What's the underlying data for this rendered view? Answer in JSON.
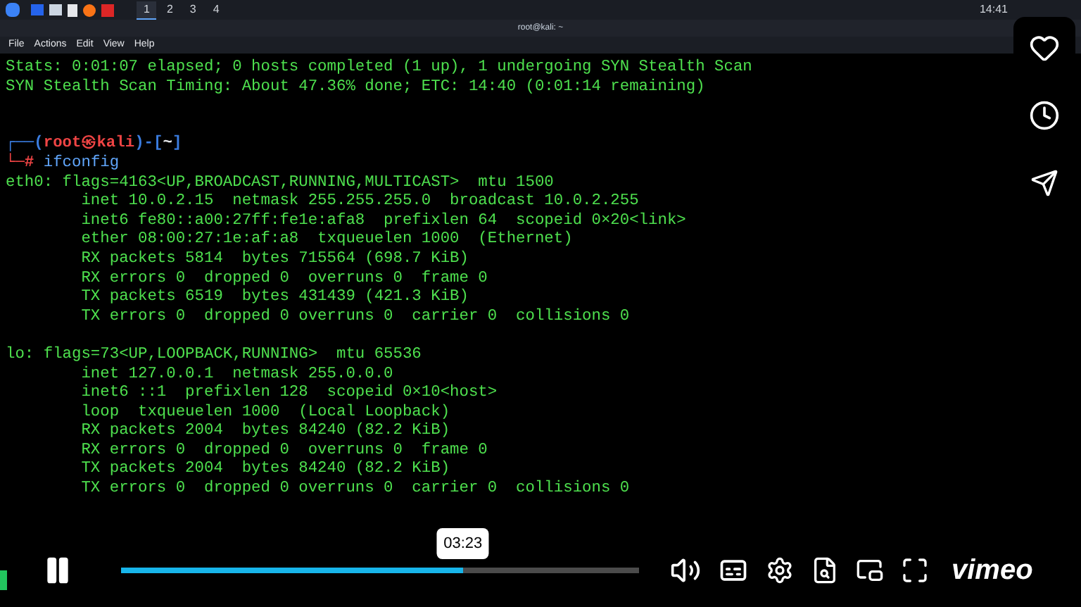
{
  "taskbar": {
    "workspaces": [
      {
        "label": "1",
        "selected": true
      },
      {
        "label": "2",
        "selected": false
      },
      {
        "label": "3",
        "selected": false
      },
      {
        "label": "4",
        "selected": false
      }
    ],
    "clock": "14:41"
  },
  "terminal": {
    "title": "root@kali: ~",
    "menu": [
      "File",
      "Actions",
      "Edit",
      "View",
      "Help"
    ],
    "lines": [
      {
        "kind": "output",
        "text": "Stats: 0:01:07 elapsed; 0 hosts completed (1 up), 1 undergoing SYN Stealth Scan"
      },
      {
        "kind": "output",
        "text": "SYN Stealth Scan Timing: About 47.36% done; ETC: 14:40 (0:01:14 remaining)"
      },
      {
        "kind": "blank"
      },
      {
        "kind": "blank"
      },
      {
        "kind": "prompt",
        "open": "┌──(",
        "user": "root㉿kali",
        "mid": ")-[",
        "dir": "~",
        "close": "]"
      },
      {
        "kind": "command",
        "mark": "└─#",
        "text": "ifconfig"
      },
      {
        "kind": "output",
        "text": "eth0: flags=4163<UP,BROADCAST,RUNNING,MULTICAST>  mtu 1500"
      },
      {
        "kind": "output",
        "text": "        inet 10.0.2.15  netmask 255.255.255.0  broadcast 10.0.2.255"
      },
      {
        "kind": "output",
        "text": "        inet6 fe80::a00:27ff:fe1e:afa8  prefixlen 64  scopeid 0×20<link>"
      },
      {
        "kind": "output",
        "text": "        ether 08:00:27:1e:af:a8  txqueuelen 1000  (Ethernet)"
      },
      {
        "kind": "output",
        "text": "        RX packets 5814  bytes 715564 (698.7 KiB)"
      },
      {
        "kind": "output",
        "text": "        RX errors 0  dropped 0  overruns 0  frame 0"
      },
      {
        "kind": "output",
        "text": "        TX packets 6519  bytes 431439 (421.3 KiB)"
      },
      {
        "kind": "output",
        "text": "        TX errors 0  dropped 0 overruns 0  carrier 0  collisions 0"
      },
      {
        "kind": "blank"
      },
      {
        "kind": "output",
        "text": "lo: flags=73<UP,LOOPBACK,RUNNING>  mtu 65536"
      },
      {
        "kind": "output",
        "text": "        inet 127.0.0.1  netmask 255.0.0.0"
      },
      {
        "kind": "output",
        "text": "        inet6 ::1  prefixlen 128  scopeid 0×10<host>"
      },
      {
        "kind": "output",
        "text": "        loop  txqueuelen 1000  (Local Loopback)"
      },
      {
        "kind": "output",
        "text": "        RX packets 2004  bytes 84240 (82.2 KiB)"
      },
      {
        "kind": "output",
        "text": "        RX errors 0  dropped 0  overruns 0  frame 0"
      },
      {
        "kind": "output",
        "text": "        TX packets 2004  bytes 84240 (82.2 KiB)"
      },
      {
        "kind": "output",
        "text": "        TX errors 0  dropped 0 overruns 0  carrier 0  collisions 0"
      }
    ]
  },
  "player": {
    "progress": {
      "level": 0.66,
      "time": "03:23"
    },
    "logo": "vimeo"
  }
}
